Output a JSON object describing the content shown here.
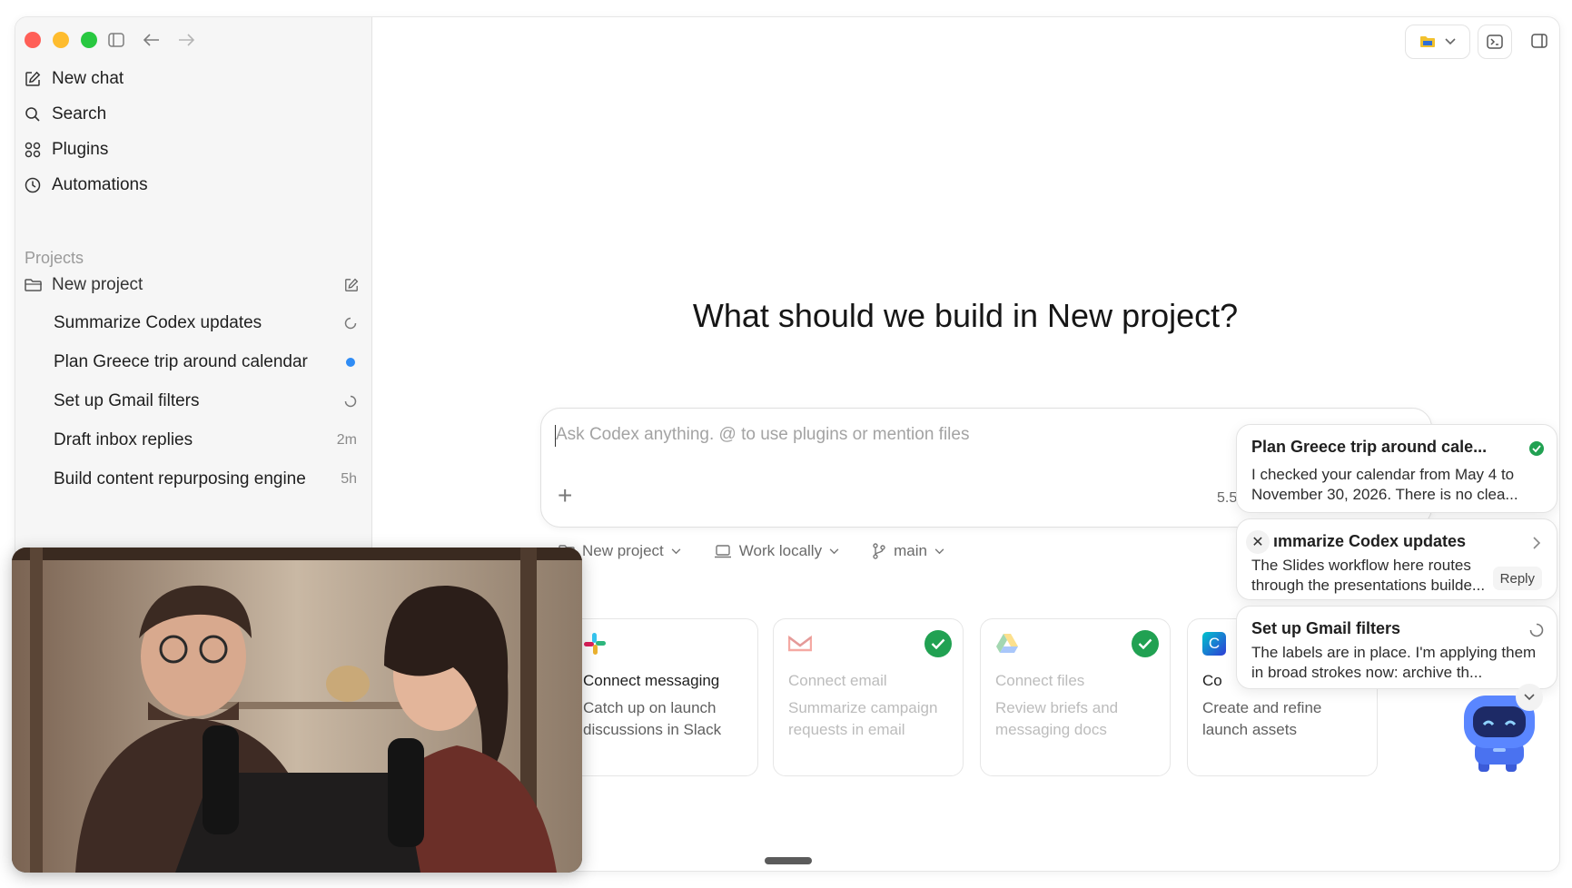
{
  "sidebar": {
    "nav": [
      {
        "label": "New chat",
        "icon": "compose-icon"
      },
      {
        "label": "Search",
        "icon": "search-icon"
      },
      {
        "label": "Plugins",
        "icon": "plugins-icon"
      },
      {
        "label": "Automations",
        "icon": "clock-icon"
      }
    ],
    "projects_label": "Projects",
    "project": {
      "label": "New project",
      "icon": "folder-icon"
    },
    "threads": [
      {
        "label": "Summarize Codex updates",
        "meta": "",
        "status": "loading"
      },
      {
        "label": "Plan Greece trip around calendar",
        "meta": "",
        "status": "unread"
      },
      {
        "label": "Set up Gmail filters",
        "meta": "",
        "status": "loading"
      },
      {
        "label": "Draft inbox replies",
        "meta": "2m",
        "status": "time"
      },
      {
        "label": "Build content repurposing engine",
        "meta": "5h",
        "status": "time"
      }
    ]
  },
  "main": {
    "title": "What should we build in New project?",
    "composer": {
      "placeholder": "Ask Codex anything. @ to use plugins or mention files",
      "meta": "5.5"
    },
    "toolbar": {
      "project": "New project",
      "mode": "Work locally",
      "branch": "main"
    },
    "cards": [
      {
        "title": "Connect messaging",
        "desc": "Catch up on launch discussions in Slack",
        "icon": "slack-icon",
        "done": false
      },
      {
        "title": "Connect email",
        "desc": "Summarize campaign requests in email",
        "icon": "gmail-icon",
        "done": true
      },
      {
        "title": "Connect files",
        "desc": "Review briefs and messaging docs",
        "icon": "drive-icon",
        "done": true
      },
      {
        "title": "Co",
        "desc": "Create and refine launch assets",
        "icon": "canva-icon",
        "done": false
      }
    ]
  },
  "notifications": [
    {
      "title": "Plan Greece trip around cale...",
      "body": "I checked your calendar from May 4 to November 30, 2026. There is no clea...",
      "status": "done"
    },
    {
      "title": "ımmarize Codex updates",
      "body": "The Slides workflow here routes through the presentations builde...",
      "action": "Reply"
    },
    {
      "title": "Set up Gmail filters",
      "body": "The labels are in place. I'm applying them in broad strokes now: archive th...",
      "status": "loading"
    }
  ],
  "colors": {
    "accent_blue": "#2f8cf5",
    "success_green": "#21a152",
    "sidebar_bg": "#f6f6f6"
  }
}
